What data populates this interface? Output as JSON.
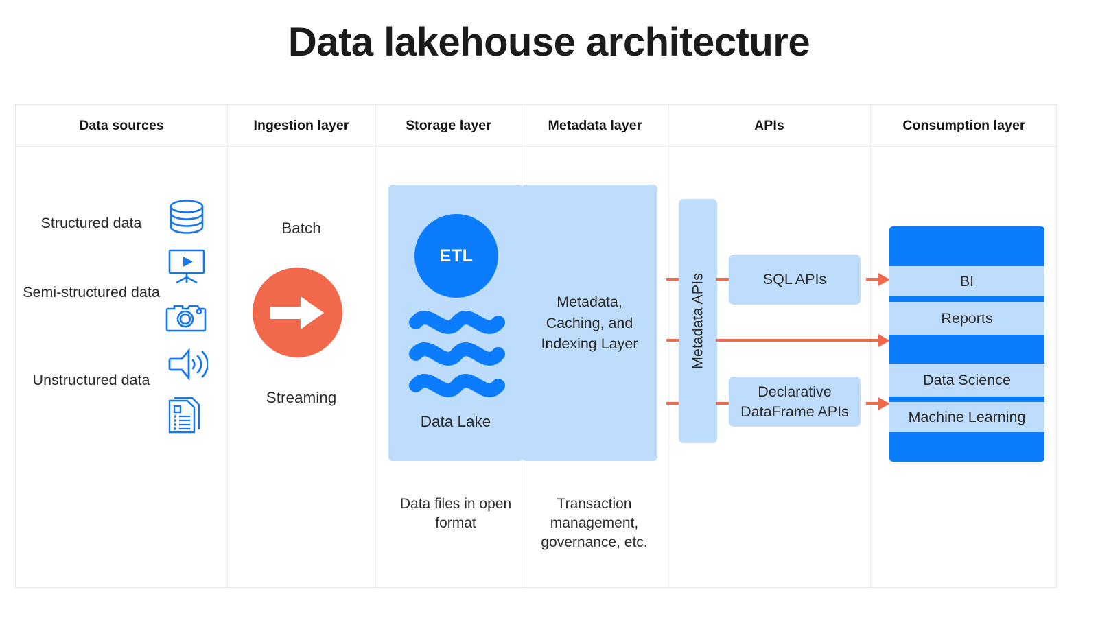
{
  "title": "Data lakehouse architecture",
  "columns": [
    {
      "id": "data-sources",
      "label": "Data sources"
    },
    {
      "id": "ingestion-layer",
      "label": "Ingestion layer"
    },
    {
      "id": "storage-layer",
      "label": "Storage layer"
    },
    {
      "id": "metadata-layer",
      "label": "Metadata layer"
    },
    {
      "id": "apis",
      "label": "APIs"
    },
    {
      "id": "consumption-layer",
      "label": "Consumption layer"
    }
  ],
  "data_sources": {
    "labels": [
      {
        "text": "Structured data"
      },
      {
        "text": "Semi-structured data"
      },
      {
        "text": "Unstructured data"
      }
    ],
    "icons": [
      {
        "name": "database-icon"
      },
      {
        "name": "video-presentation-icon"
      },
      {
        "name": "camera-icon"
      },
      {
        "name": "audio-speaker-icon"
      },
      {
        "name": "document-icon"
      }
    ]
  },
  "ingestion": {
    "top_label": "Batch",
    "bottom_label": "Streaming",
    "arrow_icon": "arrow-right-icon"
  },
  "storage": {
    "etl_label": "ETL",
    "lake_label": "Data Lake",
    "footer": "Data files in open format"
  },
  "metadata": {
    "panel_text": "Metadata, Caching, and Indexing Layer",
    "footer": "Transaction management, governance, etc."
  },
  "apis": {
    "metadata_apis_label": "Metadata APIs",
    "sql_apis_label": "SQL APIs",
    "dataframe_apis_label": "Declarative DataFrame APIs"
  },
  "consumption": {
    "items": [
      {
        "label": "BI"
      },
      {
        "label": "Reports"
      },
      {
        "label": "Data Science"
      },
      {
        "label": "Machine Learning"
      }
    ]
  },
  "colors": {
    "blue": "#0b7cfb",
    "light_blue": "#bedcfb",
    "orange": "#f1694a",
    "grid_line": "#ececec",
    "text": "#2b2b2b"
  }
}
